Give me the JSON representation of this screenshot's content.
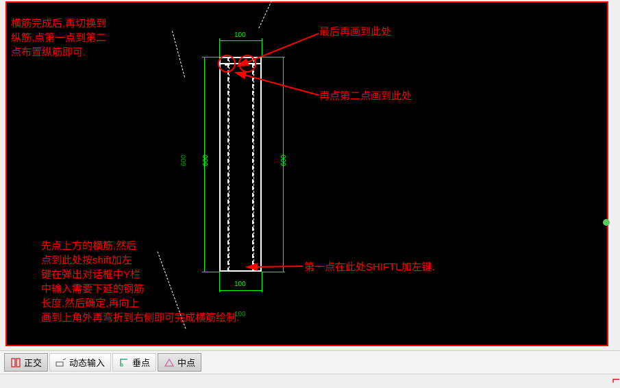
{
  "annotations": {
    "top_left": "横筋完成后,再切换到\n纵筋,点第一点到第二\n点布置纵筋即可.",
    "top_right_1": "最后再画到此处",
    "top_right_2": "再点第二点画到此处",
    "bottom_left": "先点上方的横筋,然后\n点到此处按shift加左\n键在弹出对话框中Y栏\n中输入需要下延的钢筋\n长度,然后确定,再向上\n画到上角外再弯折到右侧即可完成横筋绘制.",
    "bottom_right": "第一点在此处SHIFTL加左键."
  },
  "dimensions": {
    "top_100": "100",
    "left_600": "600",
    "left_600_inner": "600",
    "right_600": "600",
    "bottom_100": "100",
    "bottom_100_dark": "100"
  },
  "toolbar": {
    "ortho": "正交",
    "dynamic_input": "动态输入",
    "perpendicular": "垂点",
    "midpoint": "中点"
  }
}
